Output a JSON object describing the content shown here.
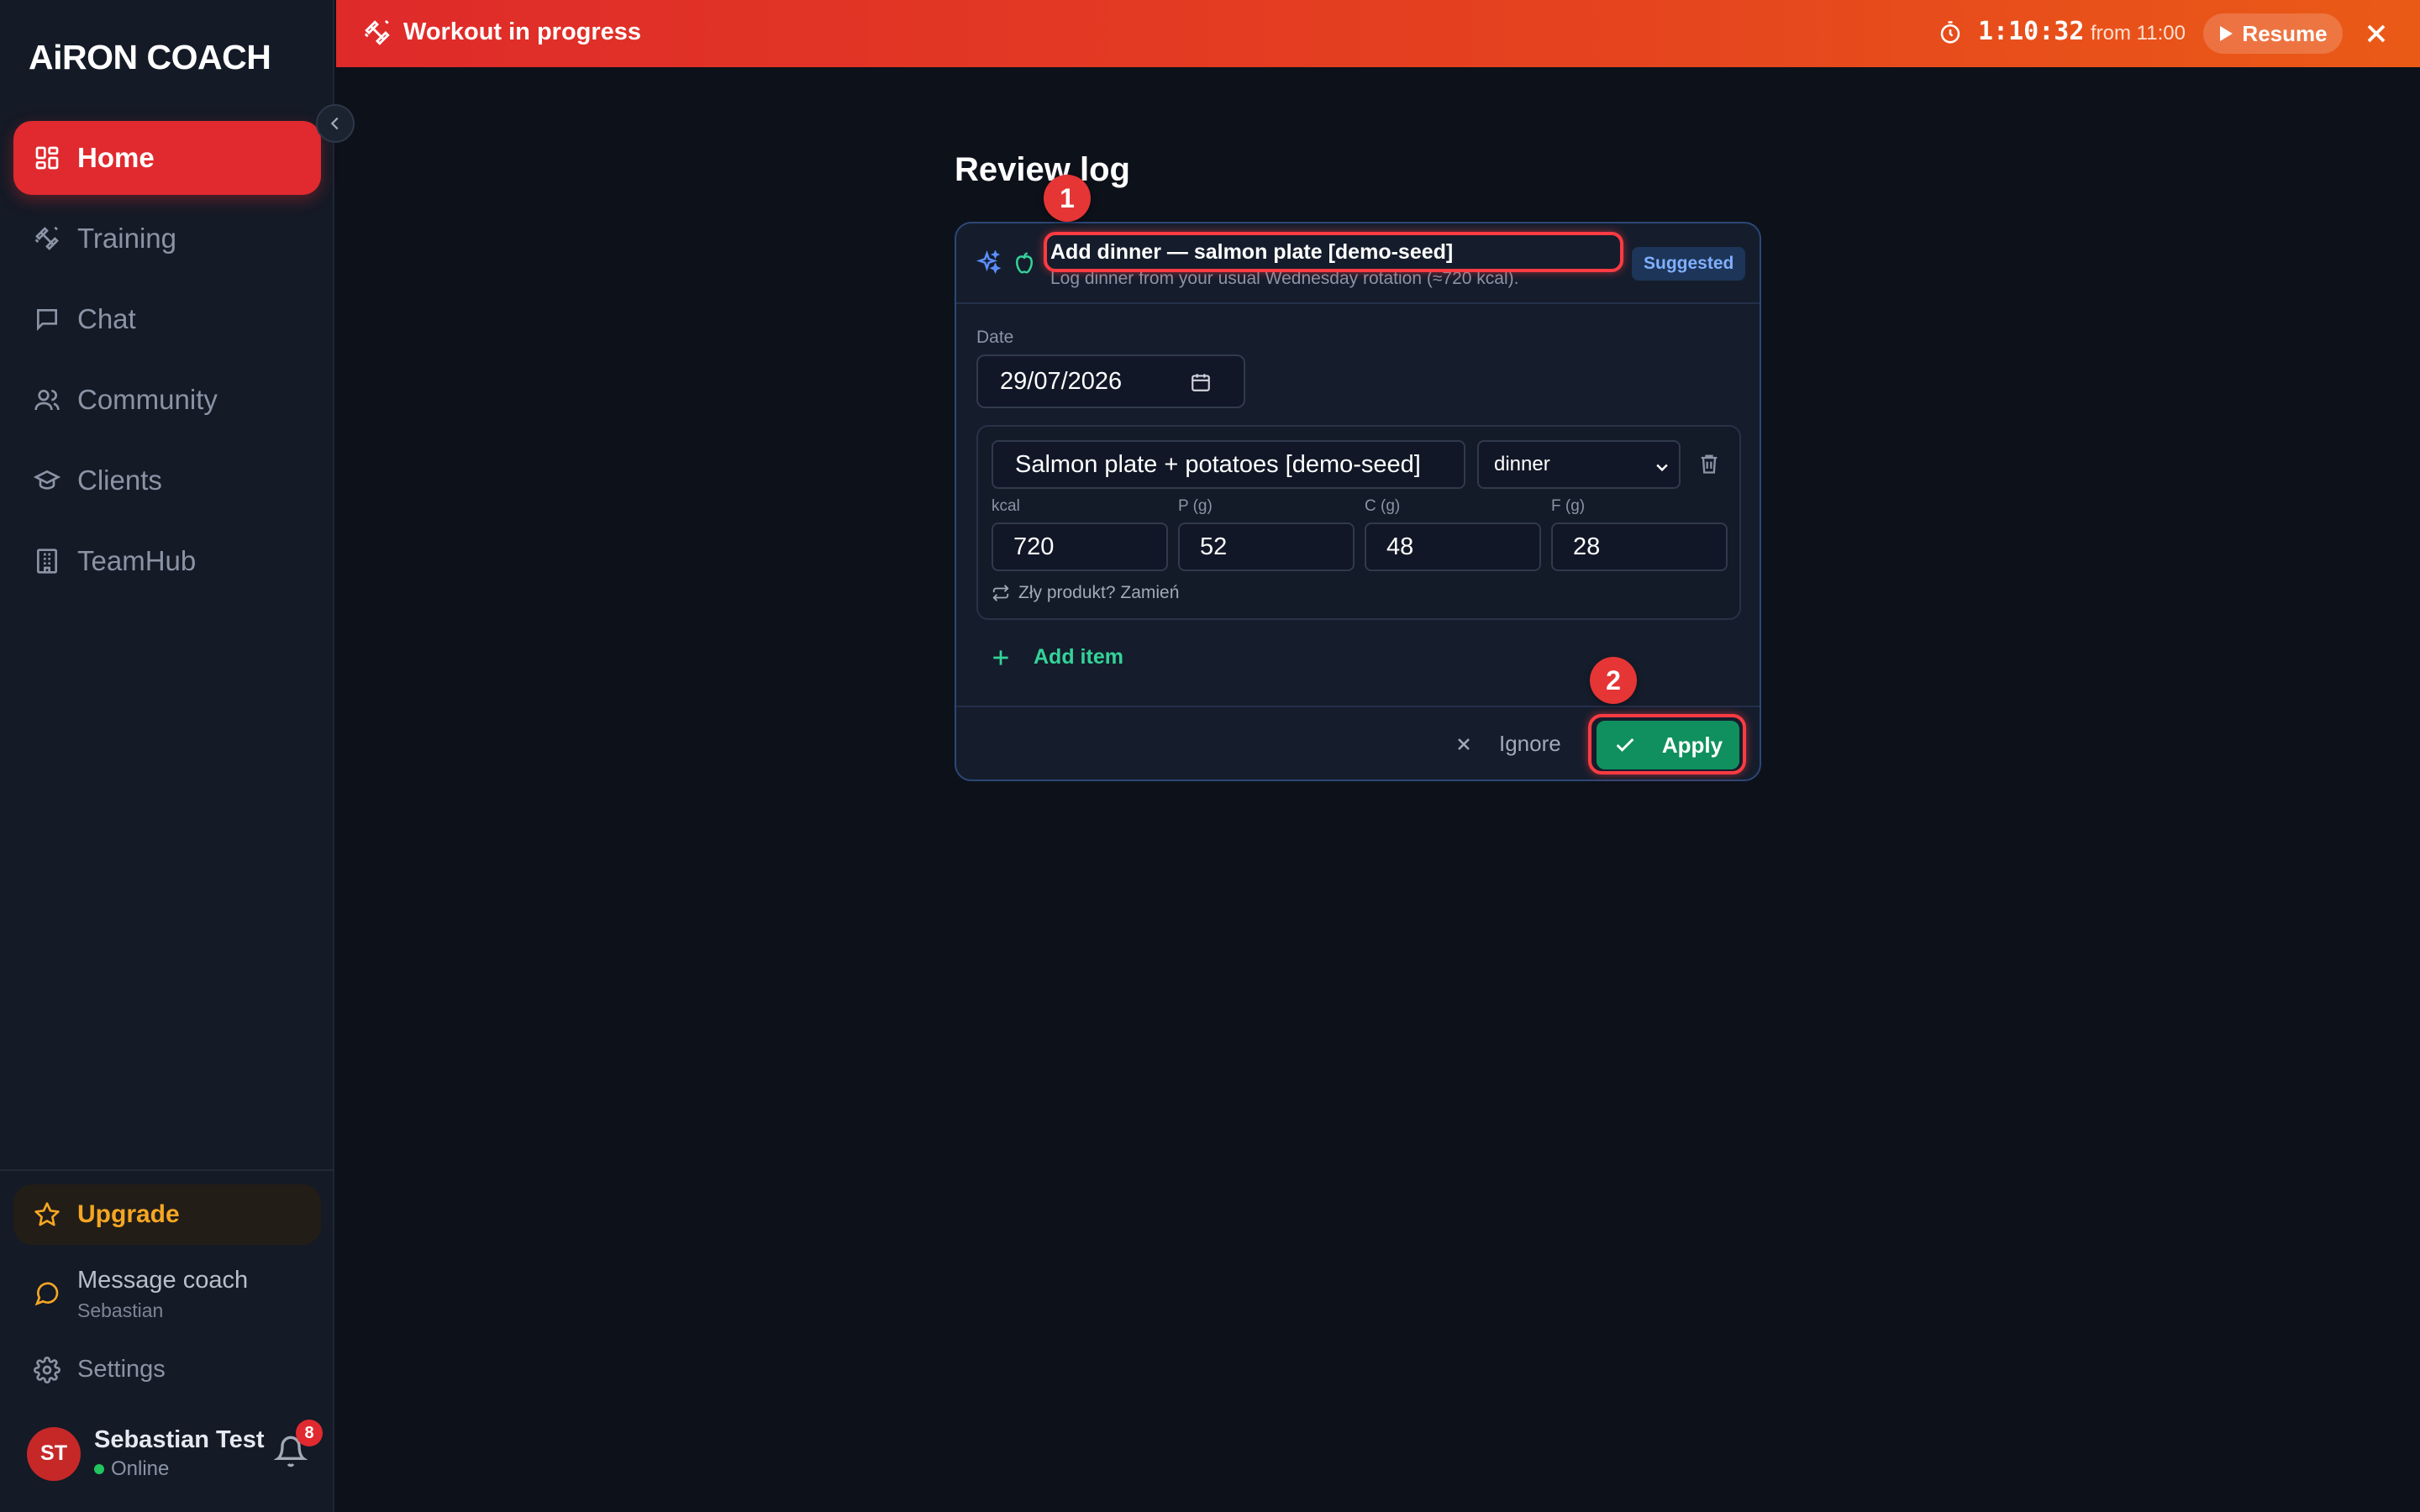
{
  "app": {
    "logo_text": "iRON COACH",
    "logo_a": "A"
  },
  "sidebar": {
    "items": [
      {
        "label": "Home",
        "icon": "grid-icon",
        "active": true
      },
      {
        "label": "Training",
        "icon": "dumbbell-icon",
        "active": false
      },
      {
        "label": "Chat",
        "icon": "chat-bubble-icon",
        "active": false
      },
      {
        "label": "Community",
        "icon": "people-icon",
        "active": false
      },
      {
        "label": "Clients",
        "icon": "graduation-cap-icon",
        "active": false
      },
      {
        "label": "TeamHub",
        "icon": "building-icon",
        "active": false
      }
    ],
    "upgrade_label": "Upgrade",
    "message_coach": {
      "label": "Message coach",
      "coach_name": "Sebastian"
    },
    "settings_label": "Settings",
    "user": {
      "initials": "ST",
      "name": "Sebastian Test",
      "status": "Online"
    },
    "notifications_count": "8"
  },
  "banner": {
    "title": "Workout in progress",
    "timer": "1:10:32",
    "from": "from 11:00",
    "resume_label": "Resume"
  },
  "main": {
    "title": "Review log",
    "card": {
      "title": "Add dinner — salmon plate [demo-seed]",
      "subtitle": "Log dinner from your usual Wednesday rotation (≈720 kcal).",
      "badge": "Suggested",
      "date_label": "Date",
      "date_value": "29/07/2026",
      "item": {
        "name": "Salmon plate + potatoes [demo-seed]",
        "meal": "dinner",
        "macros": [
          {
            "label": "kcal",
            "value": "720"
          },
          {
            "label": "P (g)",
            "value": "52"
          },
          {
            "label": "C (g)",
            "value": "48"
          },
          {
            "label": "F (g)",
            "value": "28"
          }
        ],
        "swap_label": "Zły produkt? Zamień"
      },
      "add_item_label": "Add item",
      "ignore_label": "Ignore",
      "apply_label": "Apply"
    }
  },
  "annotations": {
    "marker_1": "1",
    "marker_2": "2"
  },
  "colors": {
    "accent_red": "#e02a2f",
    "apply_green": "#10905e",
    "upgrade_gold": "#f5a623",
    "card_border": "#2c4777"
  }
}
